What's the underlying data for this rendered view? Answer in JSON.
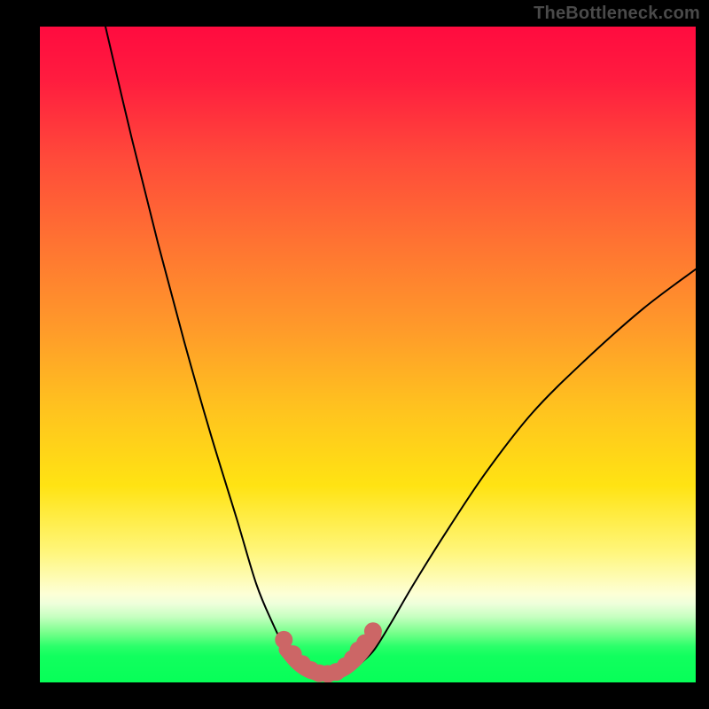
{
  "watermark": "TheBottleneck.com",
  "chart_data": {
    "type": "line",
    "title": "",
    "xlabel": "",
    "ylabel": "",
    "xlim": [
      0,
      100
    ],
    "ylim": [
      0,
      100
    ],
    "grid": false,
    "legend": false,
    "series": [
      {
        "name": "left-curve",
        "color": "#000000",
        "x": [
          10,
          14,
          18,
          22,
          26,
          30,
          33,
          35.5,
          37.5,
          39
        ],
        "y": [
          100,
          83,
          67,
          52,
          38,
          25,
          15,
          9,
          5,
          3
        ]
      },
      {
        "name": "right-curve",
        "color": "#000000",
        "x": [
          49,
          51,
          53.5,
          57,
          62,
          68,
          75,
          83,
          92,
          100
        ],
        "y": [
          3,
          5,
          9,
          15,
          23,
          32,
          41,
          49,
          57,
          63
        ]
      },
      {
        "name": "trough-highlight",
        "color": "#cc6666",
        "x": [
          37.5,
          39,
          40.5,
          42,
          43.5,
          45,
          46.5,
          48,
          49.5,
          51
        ],
        "y": [
          5.0,
          3.2,
          2.0,
          1.4,
          1.2,
          1.4,
          2.1,
          3.3,
          5.0,
          7.2
        ]
      }
    ],
    "markers": {
      "name": "trough-dots",
      "color": "#cc6666",
      "points": [
        {
          "x": 37.2,
          "y": 6.5
        },
        {
          "x": 38.6,
          "y": 4.3
        },
        {
          "x": 40.0,
          "y": 2.8
        },
        {
          "x": 41.3,
          "y": 1.9
        },
        {
          "x": 42.6,
          "y": 1.4
        },
        {
          "x": 43.9,
          "y": 1.3
        },
        {
          "x": 45.2,
          "y": 1.6
        },
        {
          "x": 46.6,
          "y": 2.5
        },
        {
          "x": 47.7,
          "y": 3.6
        },
        {
          "x": 48.6,
          "y": 4.9
        },
        {
          "x": 49.6,
          "y": 6.0
        },
        {
          "x": 50.8,
          "y": 7.8
        }
      ]
    }
  }
}
